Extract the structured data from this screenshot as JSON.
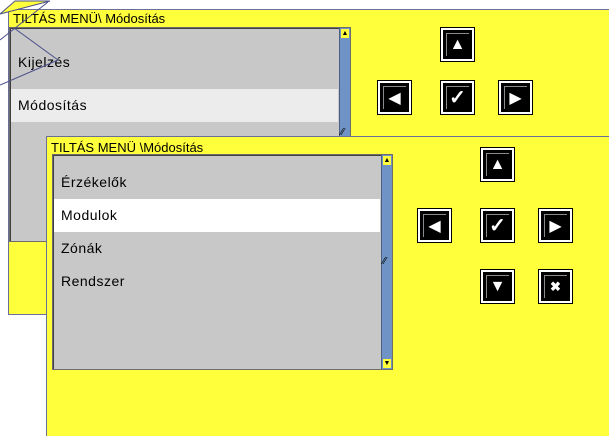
{
  "back_window": {
    "title": "TILTÁS MENÜ\\ Módosítás",
    "items": [
      {
        "label": "Kijelzés"
      },
      {
        "label": "Módosítás",
        "selected": true
      }
    ],
    "scroll_up_icon": "▲",
    "scroll_grip_icon": "⁄⁄"
  },
  "front_window": {
    "title": "TILTÁS MENÜ \\Módosítás",
    "items": [
      {
        "label": "Érzékelők"
      },
      {
        "label": "Modulok",
        "selected": true
      },
      {
        "label": "Zónák"
      },
      {
        "label": "Rendszer"
      }
    ],
    "scroll_up_icon": "▲",
    "scroll_down_icon": "▼",
    "scroll_grip_icon": "⁄⁄"
  },
  "keys": {
    "up": "▲",
    "left": "◀",
    "ok": "✓",
    "right": "▶",
    "down": "▼",
    "cancel": "✖"
  },
  "colors": {
    "panel": "#ffff3c",
    "list": "#c8c8c8",
    "scrollbar": "#6f93c4",
    "selected_back": "#ececec",
    "selected_front": "#ffffff",
    "button": "#000000"
  }
}
